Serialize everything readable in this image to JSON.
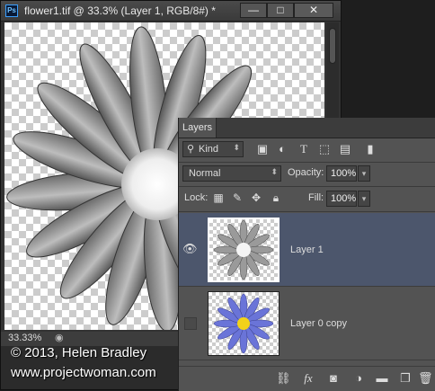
{
  "document": {
    "title": "flower1.tif @ 33.3% (Layer 1, RGB/8#) *",
    "app_icon": "Ps",
    "zoom": "33.33%",
    "window_buttons": {
      "minimize": "—",
      "maximize": "□",
      "close": "✕"
    }
  },
  "layers_panel": {
    "tab_label": "Layers",
    "filter": {
      "kind_label": "Kind",
      "icons": [
        "image-filter-icon",
        "adjustment-filter-icon",
        "type-filter-icon",
        "shape-filter-icon",
        "smart-object-filter-icon",
        "filter-toggle-icon"
      ]
    },
    "blend_mode": "Normal",
    "opacity_label": "Opacity:",
    "opacity_value": "100%",
    "lock_label": "Lock:",
    "fill_label": "Fill:",
    "fill_value": "100%",
    "layers": [
      {
        "name": "Layer 1",
        "visible": true,
        "selected": true
      },
      {
        "name": "Layer 0 copy",
        "visible": false,
        "selected": false
      }
    ],
    "bottom_icons": [
      "link-icon",
      "fx-icon",
      "mask-icon",
      "adjustment-icon",
      "folder-icon",
      "new-layer-icon",
      "trash-icon"
    ],
    "fx_label": "fx"
  },
  "watermark": {
    "line1": "© 2013, Helen Bradley",
    "line2": "www.projectwoman.com"
  },
  "colors": {
    "selected_layer": "#4c566c",
    "panel_bg": "#535353",
    "petal_blue": "#6a74d8",
    "flower_center": "#f2d21a"
  }
}
